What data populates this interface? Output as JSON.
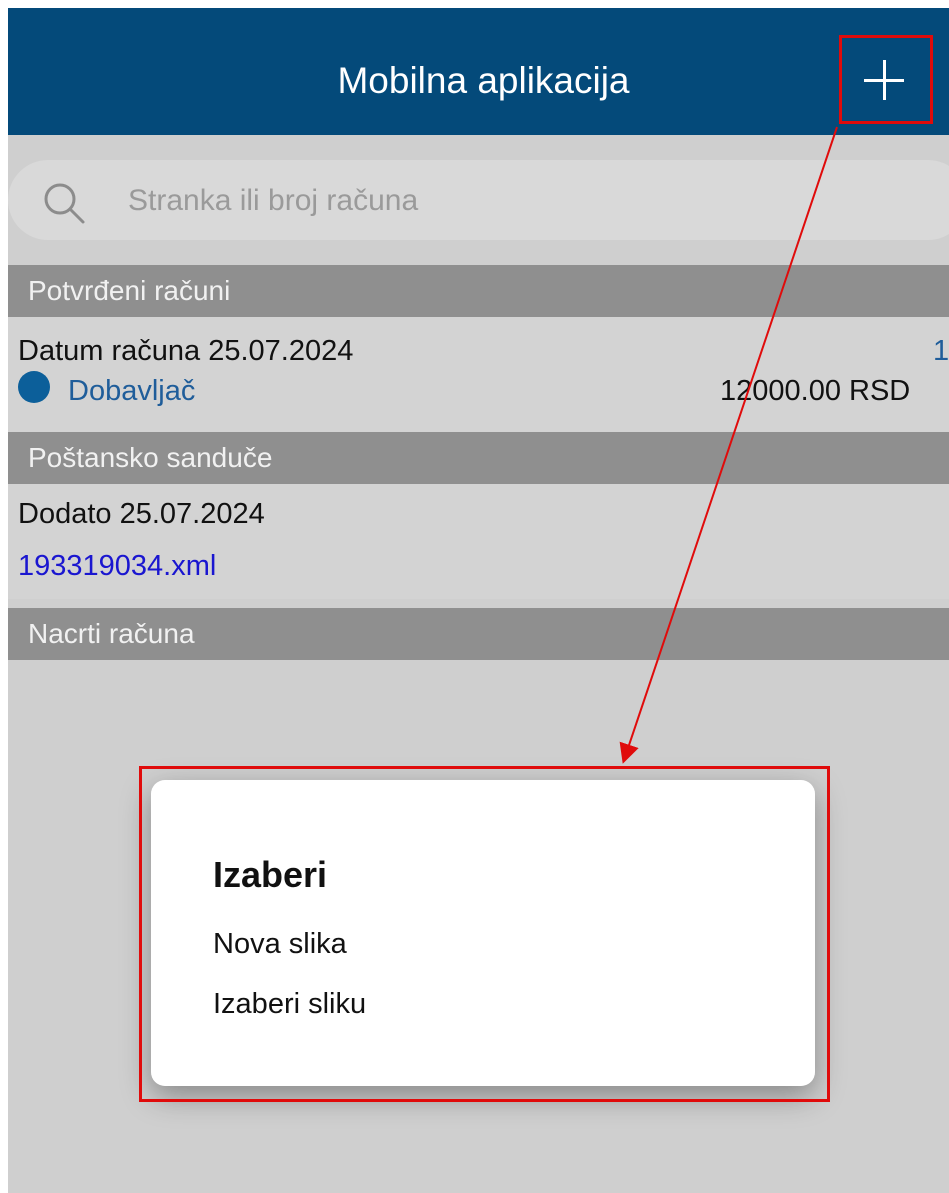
{
  "header": {
    "title": "Mobilna aplikacija",
    "add_icon": "plus-icon"
  },
  "search": {
    "placeholder": "Stranka ili broj računa",
    "icon": "search-icon"
  },
  "sections": {
    "confirmed": {
      "title": "Potvrđeni računi",
      "item": {
        "date_label": "Datum računa 25.07.2024",
        "party_label": "Dobavljač",
        "number": "1",
        "amount": "12000.00 RSD"
      }
    },
    "mailbox": {
      "title": "Poštansko sanduče",
      "item": {
        "added_label": "Dodato 25.07.2024",
        "file_name": "193319034.xml"
      }
    },
    "drafts": {
      "title": "Nacrti računa"
    }
  },
  "dialog": {
    "title": "Izaberi",
    "options": [
      "Nova slika",
      "Izaberi sliku"
    ]
  },
  "colors": {
    "header_bg": "#044a7a",
    "screen_bg": "#cfcfcf",
    "section_header_bg": "#8f8f8f",
    "accent_blue": "#0c5f9a",
    "link_blue": "#1a16d0",
    "annotation_red": "#e00b0b"
  }
}
